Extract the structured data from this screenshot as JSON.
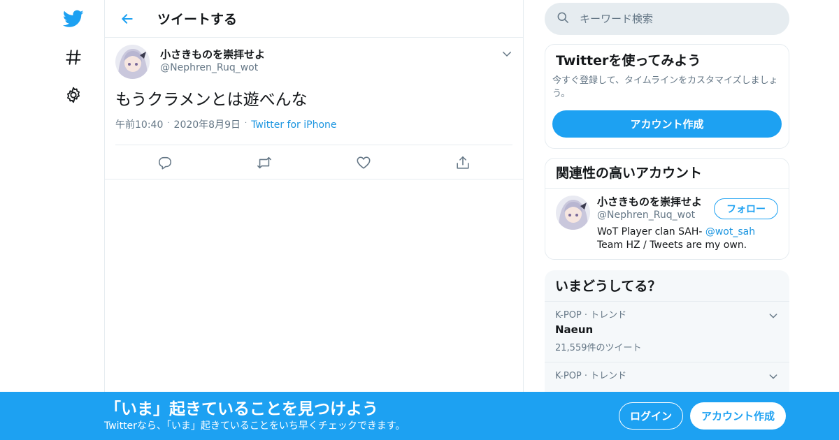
{
  "header": {
    "title": "ツイートする"
  },
  "tweet": {
    "author_name": "小さきものを崇拝せよ",
    "author_handle": "@Nephren_Ruq_wot",
    "text": "もうクラメンとは遊べんな",
    "time": "午前10:40",
    "date": "2020年8月9日",
    "source": "Twitter for iPhone"
  },
  "search": {
    "placeholder": "キーワード検索"
  },
  "signup_card": {
    "title": "Twitterを使ってみよう",
    "description": "今すぐ登録して、タイムラインをカスタマイズしましょう。",
    "button_label": "アカウント作成"
  },
  "related": {
    "title": "関連性の高いアカウント",
    "account": {
      "name": "小さきものを崇拝せよ",
      "handle": "@Nephren_Ruq_wot",
      "bio_prefix": "WoT Player clan SAH- ",
      "bio_mention": "@wot_sah",
      "bio_line2": "Team HZ / Tweets are my own.",
      "follow_label": "フォロー"
    }
  },
  "trends": {
    "title": "いまどうしてる？",
    "items": [
      {
        "category": "K-POP · トレンド",
        "name": "Naeun",
        "count": "21,559件のツイート"
      },
      {
        "category": "K-POP · トレンド",
        "name": "",
        "count": ""
      }
    ]
  },
  "banner": {
    "title": "「いま」起きていることを見つけよう",
    "subtitle": "Twitterなら、「いま」起きていることをいち早くチェックできます。",
    "login_label": "ログイン",
    "signup_label": "アカウント作成"
  },
  "colors": {
    "accent": "#1da1f2",
    "link": "#1b95e0",
    "muted": "#657786",
    "border": "#e6ecf0"
  },
  "icons": [
    "twitter-bird-icon",
    "hashtag-icon",
    "settings-gear-icon",
    "back-arrow-icon",
    "chevron-down-icon",
    "reply-icon",
    "retweet-icon",
    "like-icon",
    "share-icon",
    "search-icon"
  ]
}
